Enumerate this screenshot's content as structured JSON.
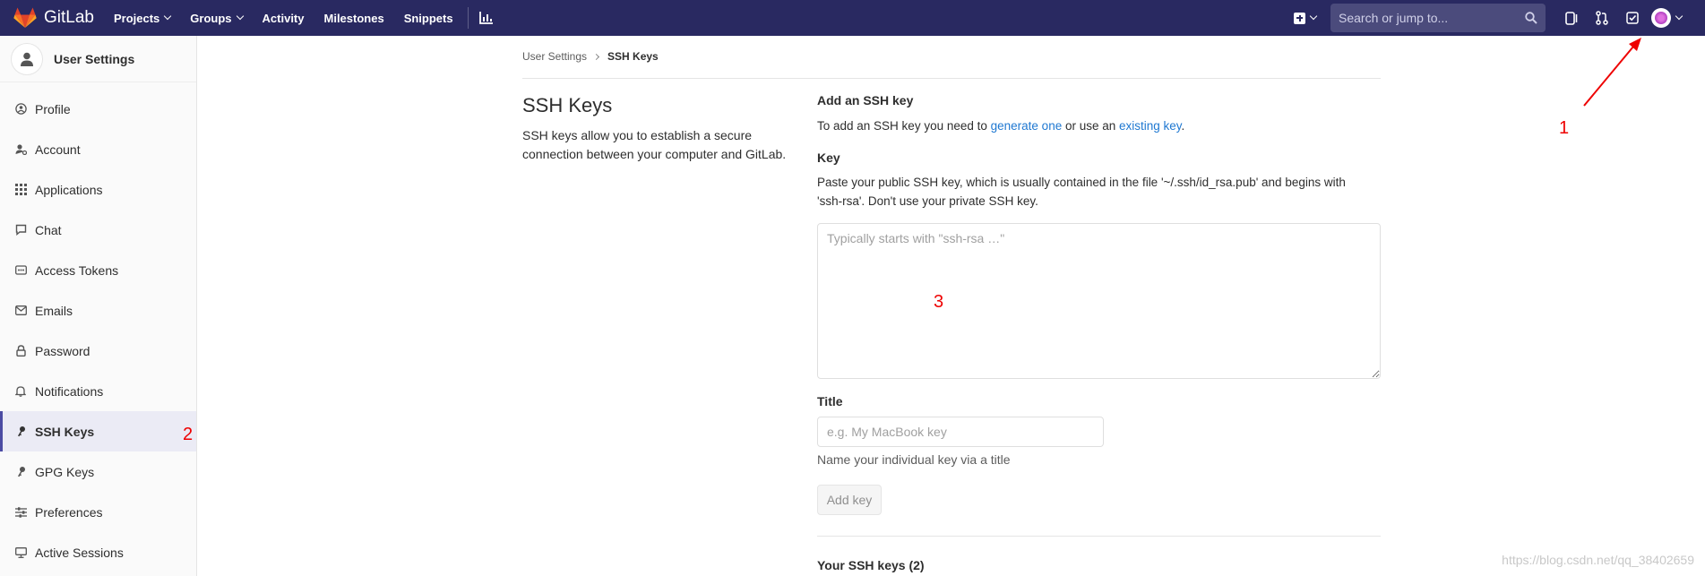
{
  "navbar": {
    "brand": "GitLab",
    "links": [
      "Projects",
      "Groups",
      "Activity",
      "Milestones",
      "Snippets"
    ],
    "search_placeholder": "Search or jump to..."
  },
  "sidebar": {
    "title": "User Settings",
    "items": [
      {
        "label": "Profile",
        "icon": "profile-icon"
      },
      {
        "label": "Account",
        "icon": "account-icon"
      },
      {
        "label": "Applications",
        "icon": "applications-icon"
      },
      {
        "label": "Chat",
        "icon": "chat-icon"
      },
      {
        "label": "Access Tokens",
        "icon": "token-icon"
      },
      {
        "label": "Emails",
        "icon": "envelope-icon"
      },
      {
        "label": "Password",
        "icon": "lock-icon"
      },
      {
        "label": "Notifications",
        "icon": "bell-icon"
      },
      {
        "label": "SSH Keys",
        "icon": "key-icon",
        "active": true
      },
      {
        "label": "GPG Keys",
        "icon": "key-icon"
      },
      {
        "label": "Preferences",
        "icon": "sliders-icon"
      },
      {
        "label": "Active Sessions",
        "icon": "monitor-icon"
      }
    ]
  },
  "breadcrumb": {
    "parent": "User Settings",
    "current": "SSH Keys"
  },
  "section": {
    "title": "SSH Keys",
    "description": "SSH keys allow you to establish a secure connection between your computer and GitLab."
  },
  "form": {
    "heading": "Add an SSH key",
    "intro_pre": "To add an SSH key you need to ",
    "intro_link1": "generate one",
    "intro_mid": " or use an ",
    "intro_link2": "existing key",
    "intro_post": ".",
    "key_label": "Key",
    "key_help": "Paste your public SSH key, which is usually contained in the file '~/.ssh/id_rsa.pub' and begins with 'ssh-rsa'. Don't use your private SSH key.",
    "key_placeholder": "Typically starts with \"ssh-rsa …\"",
    "title_label": "Title",
    "title_placeholder": "e.g. My MacBook key",
    "title_help": "Name your individual key via a title",
    "add_button": "Add key",
    "your_keys": "Your SSH keys (2)"
  },
  "annotations": {
    "a1": "1",
    "a2": "2",
    "a3": "3",
    "color": "#e00000"
  },
  "watermark": "https://blog.csdn.net/qq_38402659"
}
